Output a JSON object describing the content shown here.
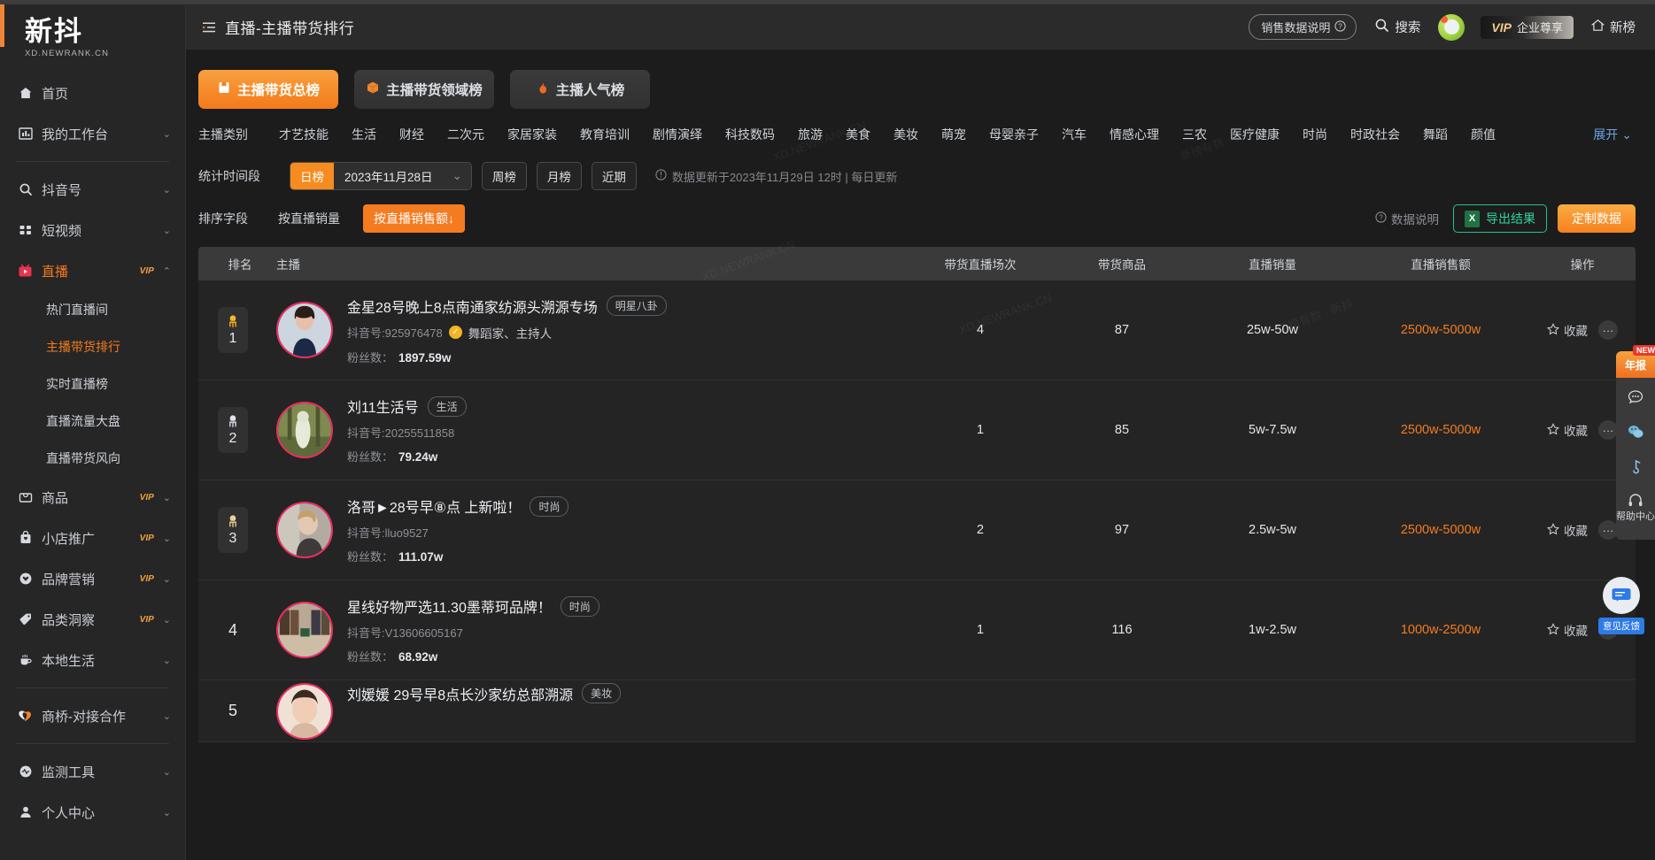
{
  "brand": {
    "name": "新抖",
    "domain": "XD.NEWRANK.CN"
  },
  "sidebar": {
    "items": [
      {
        "label": "首页",
        "icon": "home-icon",
        "vip": "",
        "chevron": "",
        "active": false
      },
      {
        "label": "我的工作台",
        "icon": "dashboard-icon",
        "vip": "",
        "chevron": "⌄",
        "active": false
      },
      {
        "label": "抖音号",
        "icon": "search-icon",
        "vip": "",
        "chevron": "⌄",
        "active": false
      },
      {
        "label": "短视频",
        "icon": "grid-icon",
        "vip": "",
        "chevron": "⌄",
        "active": false
      },
      {
        "label": "直播",
        "icon": "live-icon",
        "vip": "VIP",
        "chevron": "⌃",
        "active": true
      },
      {
        "label": "商品",
        "icon": "bag-icon",
        "vip": "VIP",
        "chevron": "⌄",
        "active": false
      },
      {
        "label": "小店推广",
        "icon": "shop-icon",
        "vip": "VIP",
        "chevron": "⌄",
        "active": false
      },
      {
        "label": "品牌营销",
        "icon": "heart-icon",
        "vip": "VIP",
        "chevron": "⌄",
        "active": false
      },
      {
        "label": "品类洞察",
        "icon": "tag-icon",
        "vip": "VIP",
        "chevron": "⌄",
        "active": false
      },
      {
        "label": "本地生活",
        "icon": "cup-icon",
        "vip": "",
        "chevron": "⌄",
        "active": false
      },
      {
        "label": "商桥-对接合作",
        "icon": "bridge-icon",
        "vip": "",
        "chevron": "⌄",
        "active": false
      },
      {
        "label": "监测工具",
        "icon": "monitor-icon",
        "vip": "",
        "chevron": "⌄",
        "active": false
      },
      {
        "label": "个人中心",
        "icon": "user-icon",
        "vip": "",
        "chevron": "⌄",
        "active": false
      }
    ],
    "live_subitems": [
      {
        "label": "热门直播间",
        "active": false
      },
      {
        "label": "主播带货排行",
        "active": true
      },
      {
        "label": "实时直播榜",
        "active": false
      },
      {
        "label": "直播流量大盘",
        "active": false
      },
      {
        "label": "直播带货风向",
        "active": false
      }
    ]
  },
  "header": {
    "collapse_icon": "collapse-menu-icon",
    "title": "直播-主播带货排行",
    "sales_note": "销售数据说明",
    "search": "搜索",
    "vip_prefix": "VIP",
    "vip_label": "企业尊享",
    "newrank": "新榜"
  },
  "tabs": [
    {
      "label": "主播带货总榜",
      "icon": "board-icon",
      "active": true
    },
    {
      "label": "主播带货领域榜",
      "icon": "box-icon",
      "active": false
    },
    {
      "label": "主播人气榜",
      "icon": "fire-icon",
      "active": false
    }
  ],
  "categories": {
    "label": "主播类别",
    "items": [
      "才艺技能",
      "生活",
      "财经",
      "二次元",
      "家居家装",
      "教育培训",
      "剧情演绎",
      "科技数码",
      "旅游",
      "美食",
      "美妆",
      "萌宠",
      "母婴亲子",
      "汽车",
      "情感心理",
      "三农",
      "医疗健康",
      "时尚",
      "时政社会",
      "舞蹈",
      "颜值"
    ],
    "expand": "展开"
  },
  "time": {
    "label": "统计时间段",
    "mode": "日榜",
    "date": "2023年11月28日",
    "week": "周榜",
    "month": "月榜",
    "recent": "近期",
    "update_note": "数据更新于2023年11月29日 12时 | 每日更新"
  },
  "sort": {
    "label": "排序字段",
    "by_volume": "按直播销量",
    "by_amount": "按直播销售额",
    "data_note": "数据说明",
    "export": "导出结果",
    "custom": "定制数据"
  },
  "table": {
    "columns": [
      "排名",
      "主播",
      "带货直播场次",
      "带货商品",
      "直播销量",
      "直播销售额",
      "操作"
    ],
    "rows": [
      {
        "rank": "1",
        "medal": "gold",
        "name": "金星28号晚上8点南通家纺源头溯源专场",
        "tag": "明星八卦",
        "douyin_label": "抖音号:925976478",
        "verified": true,
        "role": "舞蹈家、主持人",
        "fans_label": "粉丝数：",
        "fans": "1897.59w",
        "sessions": "4",
        "products": "87",
        "volume": "25w-50w",
        "amount": "2500w-5000w",
        "fav": "收藏",
        "more": "···",
        "avatar_colors": [
          "#cdd5de",
          "#1c2944",
          "#8a5b52"
        ]
      },
      {
        "rank": "2",
        "medal": "silver",
        "name": "刘11生活号",
        "tag": "生活",
        "douyin_label": "抖音号:20255511858",
        "verified": false,
        "role": "",
        "fans_label": "粉丝数：",
        "fans": "79.24w",
        "sessions": "1",
        "products": "85",
        "volume": "5w-7.5w",
        "amount": "2500w-5000w",
        "fav": "收藏",
        "more": "···",
        "avatar_colors": [
          "#6f7a4a",
          "#cfd3c0",
          "#3d4428"
        ]
      },
      {
        "rank": "3",
        "medal": "bronze",
        "name": "洛哥►28号早⑧点 上新啦！",
        "tag": "时尚",
        "douyin_label": "抖音号:lluo9527",
        "verified": false,
        "role": "",
        "fans_label": "粉丝数：",
        "fans": "111.07w",
        "sessions": "2",
        "products": "97",
        "volume": "2.5w-5w",
        "amount": "2500w-5000w",
        "fav": "收藏",
        "more": "···",
        "avatar_colors": [
          "#9a8f86",
          "#d8cfc6",
          "#3b332e"
        ]
      },
      {
        "rank": "4",
        "medal": "",
        "name": "星线好物严选11.30墨蒂珂品牌！",
        "tag": "时尚",
        "douyin_label": "抖音号:V13606605167",
        "verified": false,
        "role": "",
        "fans_label": "粉丝数：",
        "fans": "68.92w",
        "sessions": "1",
        "products": "116",
        "volume": "1w-2.5w",
        "amount": "1000w-2500w",
        "fav": "收藏",
        "more": "···",
        "avatar_colors": [
          "#6b5a4c",
          "#c9bfae",
          "#2e2722"
        ]
      },
      {
        "rank": "5",
        "medal": "",
        "name": "刘媛媛 29号早8点长沙家纺总部溯源",
        "tag": "美妆",
        "douyin_label": "",
        "verified": false,
        "role": "",
        "fans_label": "",
        "fans": "",
        "sessions": "",
        "products": "",
        "volume": "",
        "amount": "",
        "fav": "",
        "more": "",
        "avatar_colors": [
          "#e4c9b4",
          "#f0ddd0",
          "#7b5a43"
        ]
      }
    ]
  },
  "rail": {
    "year_badge": "年报",
    "new_badge": "NEW",
    "items": [
      {
        "icon": "chat-icon",
        "text": ""
      },
      {
        "icon": "wechat-icon",
        "text": ""
      },
      {
        "icon": "music-icon",
        "text": ""
      },
      {
        "icon": "headset-icon",
        "text": "帮助中心"
      }
    ],
    "feedback": "意见反馈"
  },
  "watermarks": [
    "XD.NEWRANK.CN",
    "新榜有数 · 新抖",
    "XD.NEWRANK.CN",
    "新榜有数 · 新抖",
    "XD.NEWRANK.CN"
  ],
  "colors": {
    "accent": "#f47b20",
    "green": "#23c38a",
    "pink": "#ef2d63",
    "blue": "#6ba4e8"
  }
}
